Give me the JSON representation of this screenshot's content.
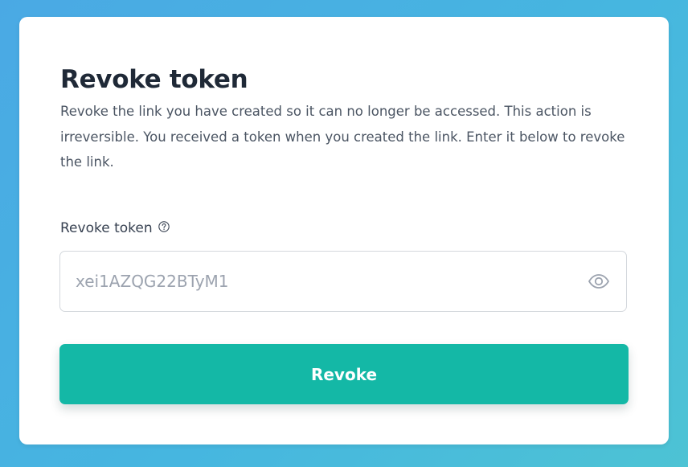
{
  "card": {
    "title": "Revoke token",
    "description": "Revoke the link you have created so it can no longer be accessed. This action is irreversible. You received a token when you created the link. Enter it below to revoke the link."
  },
  "token_field": {
    "label": "Revoke token",
    "help_icon": "question-circle-icon",
    "value": "",
    "placeholder": "xei1AZQG22BTyM1",
    "toggle_icon": "eye-icon"
  },
  "revoke_button": {
    "label": "Revoke"
  },
  "colors": {
    "background": "#46b6e0",
    "card": "#ffffff",
    "title": "#1f2937",
    "text": "#4b5563",
    "placeholder": "#9ca3af",
    "button": "#14b8a6",
    "button_text": "#ffffff"
  }
}
